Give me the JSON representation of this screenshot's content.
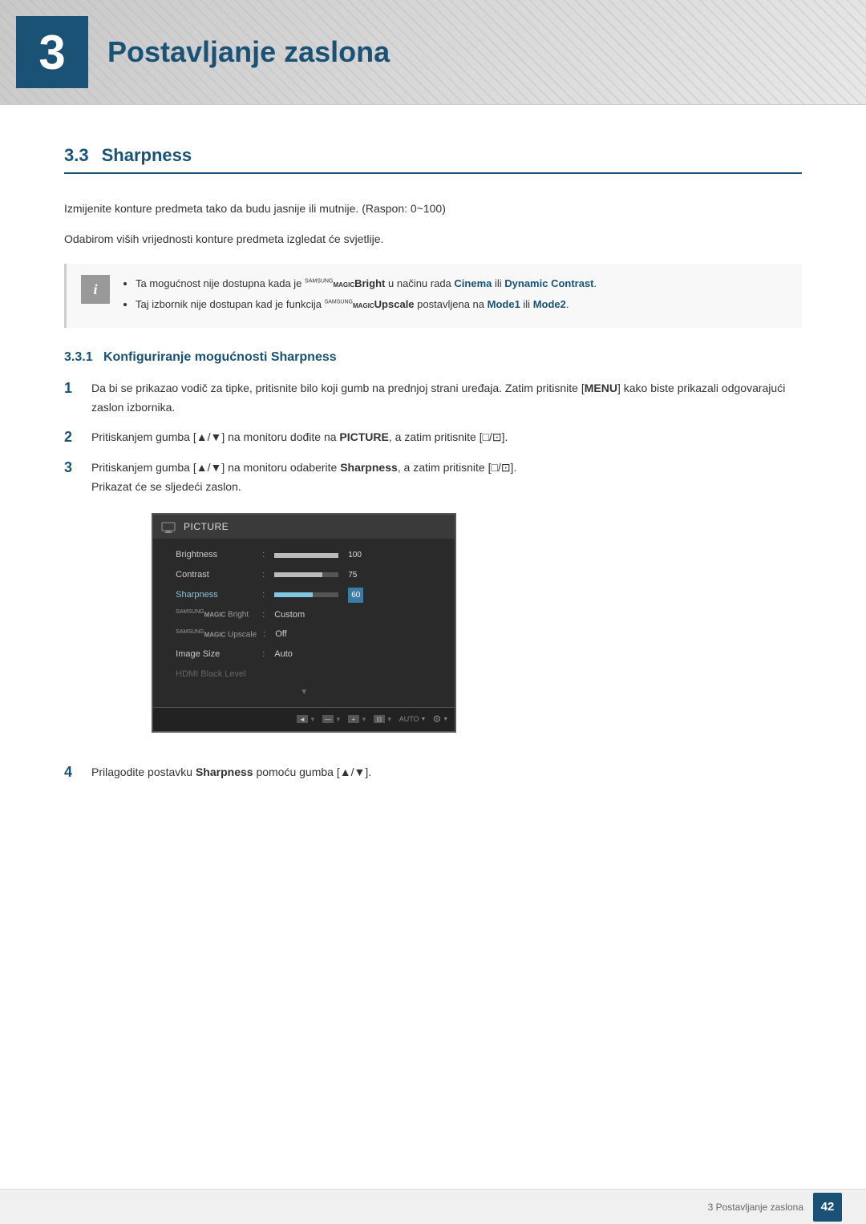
{
  "header": {
    "chapter_number": "3",
    "title": "Postavljanje zaslona"
  },
  "section": {
    "number": "3.3",
    "title": "Sharpness",
    "description1": "Izmijenite konture predmeta tako da budu jasnije ili mutnije. (Raspon: 0~100)",
    "description2": "Odabirom viših vrijednosti konture predmeta izgledat će svjetlije.",
    "notes": [
      "Ta mogućnost nije dostupna kada je SAMSUNG MAGIC Bright u načinu rada Cinema ili Dynamic Contrast.",
      "Taj izbornik nije dostupan kad je funkcija SAMSUNG MAGIC Upscale postavljena na Mode1 ili Mode2."
    ],
    "subsection": {
      "number": "3.3.1",
      "title": "Konfiguriranje mogućnosti Sharpness"
    },
    "steps": [
      {
        "number": "1",
        "text": "Da bi se prikazao vodič za tipke, pritisnite bilo koji gumb na prednjoj strani uređaja. Zatim pritisnite [MENU] kako biste prikazali odgovarajući zaslon izbornika."
      },
      {
        "number": "2",
        "text": "Pritiskanjem gumba [▲/▼] na monitoru dođite na PICTURE, a zatim pritisnite [□/⊡]."
      },
      {
        "number": "3",
        "text": "Pritiskanjem gumba [▲/▼] na monitoru odaberite Sharpness, a zatim pritisnite [□/⊡].",
        "subtext": "Prikazat će se sljedeći zaslon."
      },
      {
        "number": "4",
        "text": "Prilagodite postavku Sharpness pomoću gumba [▲/▼]."
      }
    ],
    "monitor": {
      "title": "PICTURE",
      "rows": [
        {
          "label": "Brightness",
          "type": "slider",
          "fill": "100",
          "value": "100"
        },
        {
          "label": "Contrast",
          "type": "slider",
          "fill": "75",
          "value": "75"
        },
        {
          "label": "Sharpness",
          "type": "slider",
          "fill": "60",
          "value": "60",
          "highlighted": true
        },
        {
          "label": "SAMSUNG MAGIC Bright",
          "type": "value",
          "value": "Custom"
        },
        {
          "label": "SAMSUNG MAGIC Upscale",
          "type": "value",
          "value": "Off"
        },
        {
          "label": "Image Size",
          "type": "value",
          "value": "Auto"
        },
        {
          "label": "HDMI Black Level",
          "type": "value",
          "value": ""
        }
      ],
      "buttons": [
        "◄",
        "—",
        "+",
        "⊡",
        "AUTO",
        "⚙"
      ]
    }
  },
  "footer": {
    "label": "3 Postavljanje zaslona",
    "page": "42"
  }
}
